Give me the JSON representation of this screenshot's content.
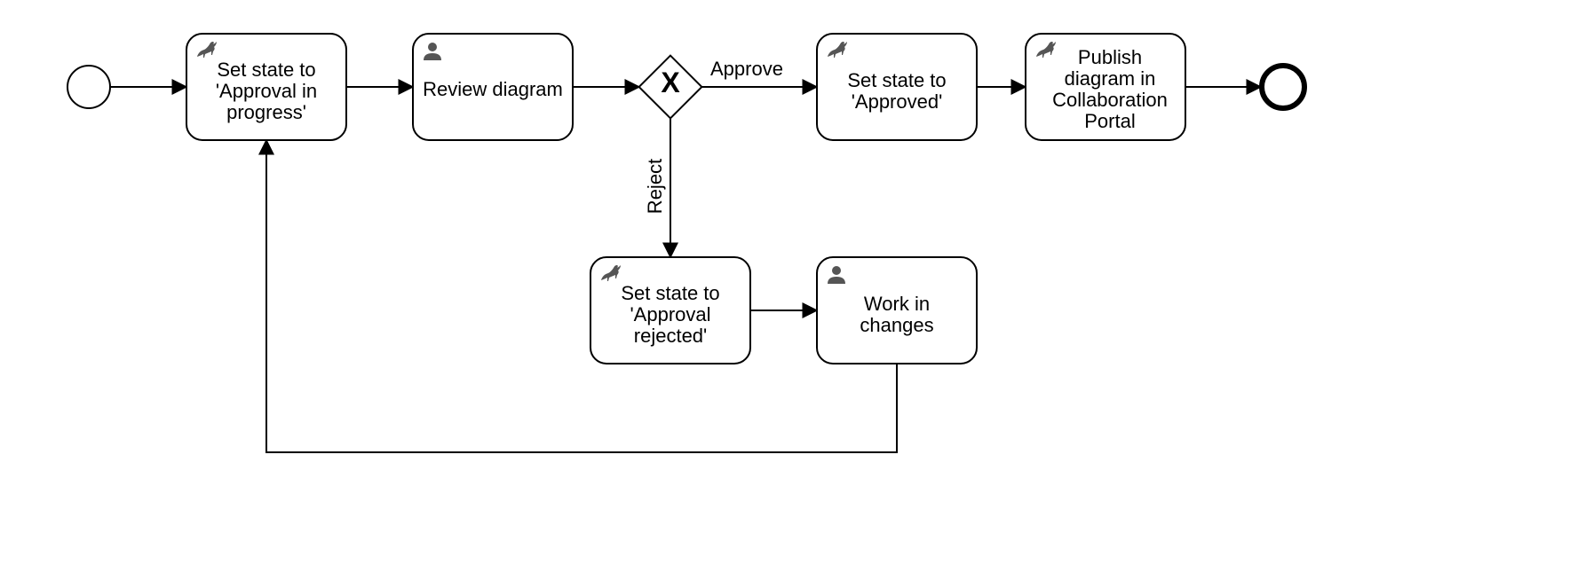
{
  "diagram": {
    "type": "BPMN",
    "nodes": {
      "start": {
        "kind": "startEvent"
      },
      "task_set_in_progress": {
        "kind": "serviceTask",
        "icon": "antelope",
        "label_lines": [
          "Set state to",
          "'Approval in",
          "progress'"
        ]
      },
      "task_review": {
        "kind": "userTask",
        "icon": "user",
        "label_lines": [
          "Review diagram"
        ]
      },
      "gateway_decision": {
        "kind": "exclusiveGateway"
      },
      "task_set_approved": {
        "kind": "serviceTask",
        "icon": "antelope",
        "label_lines": [
          "Set state to",
          "'Approved'"
        ]
      },
      "task_publish": {
        "kind": "serviceTask",
        "icon": "antelope",
        "label_lines": [
          "Publish",
          "diagram in",
          "Collaboration",
          "Portal"
        ]
      },
      "end": {
        "kind": "endEvent"
      },
      "task_set_rejected": {
        "kind": "serviceTask",
        "icon": "antelope",
        "label_lines": [
          "Set state to",
          "'Approval",
          "rejected'"
        ]
      },
      "task_work_changes": {
        "kind": "userTask",
        "icon": "user",
        "label_lines": [
          "Work in",
          "changes"
        ]
      }
    },
    "edges": [
      {
        "from": "start",
        "to": "task_set_in_progress"
      },
      {
        "from": "task_set_in_progress",
        "to": "task_review"
      },
      {
        "from": "task_review",
        "to": "gateway_decision"
      },
      {
        "from": "gateway_decision",
        "to": "task_set_approved",
        "label": "Approve"
      },
      {
        "from": "task_set_approved",
        "to": "task_publish"
      },
      {
        "from": "task_publish",
        "to": "end"
      },
      {
        "from": "gateway_decision",
        "to": "task_set_rejected",
        "label": "Reject"
      },
      {
        "from": "task_set_rejected",
        "to": "task_work_changes"
      },
      {
        "from": "task_work_changes",
        "to": "task_set_in_progress"
      }
    ]
  }
}
